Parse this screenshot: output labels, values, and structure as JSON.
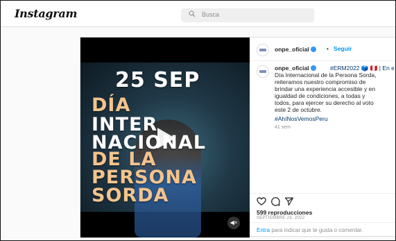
{
  "app": {
    "logo_text": "Instagram",
    "search_placeholder": "Busca"
  },
  "video": {
    "overlay_lines": [
      "25 SEP",
      "DÍA",
      "INTER",
      "NACIONAL",
      "DE LA",
      "PERSONA",
      "SORDA"
    ],
    "sound_icon": "volume-off-icon",
    "play_icon": "play-icon"
  },
  "post": {
    "username": "onpe_oficial",
    "dot": "•",
    "follow_label": "Seguir",
    "caption": {
      "username": "onpe_oficial",
      "hashtag_inline": "#ERM2022 🗳️ 🇵🇪 | En e",
      "lines": [
        "Día Internacional de la Persona Sorda,",
        "reiteramos nuestro compromiso de",
        "brindar una experiencia accesible y en",
        "igualdad de condiciones, a todas y",
        "todos, para ejercer su derecho al voto",
        "este 2 de octubre."
      ],
      "hashtag": "#AhíNosVemosPeru",
      "time_ago": "41 sem"
    },
    "views": "599 reproducciones",
    "date": "SEPTIEMBRE 23, 2022",
    "login_link": "Entra",
    "login_rest": " para indicar que te gusta o comentar."
  },
  "colors": {
    "link": "#0095f6",
    "hashtag": "#00376b",
    "accent_text": "#f3c48d"
  }
}
